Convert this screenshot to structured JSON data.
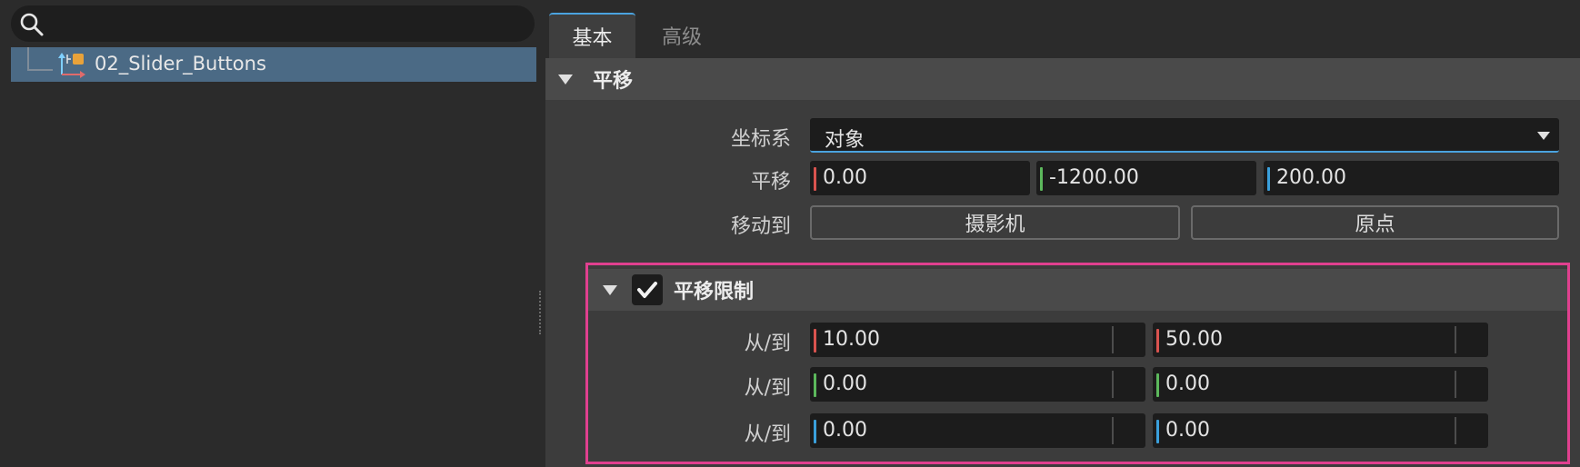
{
  "outliner": {
    "search_placeholder": "",
    "items": [
      {
        "label": "02_Slider_Buttons",
        "icon": "null-object-icon",
        "selected": true
      }
    ]
  },
  "tabs": [
    {
      "label": "基本",
      "active": true
    },
    {
      "label": "高级",
      "active": false
    }
  ],
  "translation_section": {
    "title": "平移",
    "coordinate_label": "坐标系",
    "coordinate_value": "对象",
    "translate_label": "平移",
    "translate_x": "0.00",
    "translate_y": "-1200.00",
    "translate_z": "200.00",
    "move_to_label": "移动到",
    "camera_button": "摄影机",
    "origin_button": "原点"
  },
  "limit_section": {
    "title": "平移限制",
    "checked": true,
    "rows": [
      {
        "label": "从/到",
        "from": "10.00",
        "to": "50.00",
        "axis": "x"
      },
      {
        "label": "从/到",
        "from": "0.00",
        "to": "0.00",
        "axis": "y"
      },
      {
        "label": "从/到",
        "from": "0.00",
        "to": "0.00",
        "axis": "z"
      }
    ]
  },
  "colors": {
    "accent": "#4aa3df",
    "axis_x": "#d9534f",
    "axis_y": "#5cb85c",
    "axis_z": "#3aa0dc",
    "highlight": "#e0408f",
    "selection": "#4b6a85"
  }
}
